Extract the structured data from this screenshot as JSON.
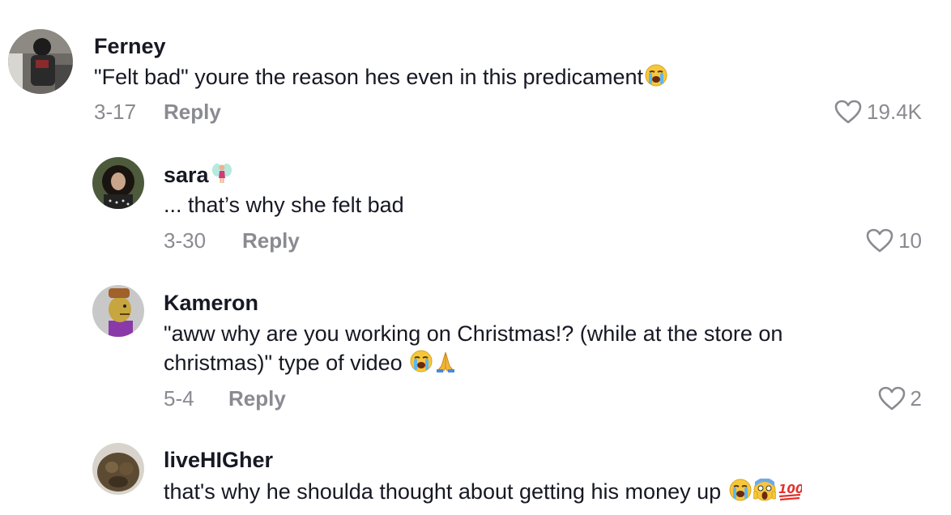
{
  "comments": [
    {
      "username": "Ferney",
      "text": "\"Felt bad\" youre the reason hes even in this predicament",
      "emojis": [
        "loudly-crying-face"
      ],
      "date": "3-17",
      "reply_label": "Reply",
      "likes": "19.4K"
    },
    {
      "username": "sara",
      "username_emoji": "fairy",
      "text": "... that’s why she felt bad",
      "date": "3-30",
      "reply_label": "Reply",
      "likes": "10"
    },
    {
      "username": "Kameron",
      "text_line1": "\"aww why are you working on Christmas!? (while at the store on",
      "text_line2": "christmas)\" type of video ",
      "emojis": [
        "loudly-crying-face",
        "folded-hands"
      ],
      "date": "5-4",
      "reply_label": "Reply",
      "likes": "2"
    },
    {
      "username": "liveHIGher",
      "text": "that's why he shoulda thought about getting his money up ",
      "emojis": [
        "loudly-crying-face",
        "screaming-face",
        "hundred-points"
      ]
    }
  ],
  "colors": {
    "text": "#161823",
    "muted": "#8a8b91",
    "background": "#ffffff"
  }
}
